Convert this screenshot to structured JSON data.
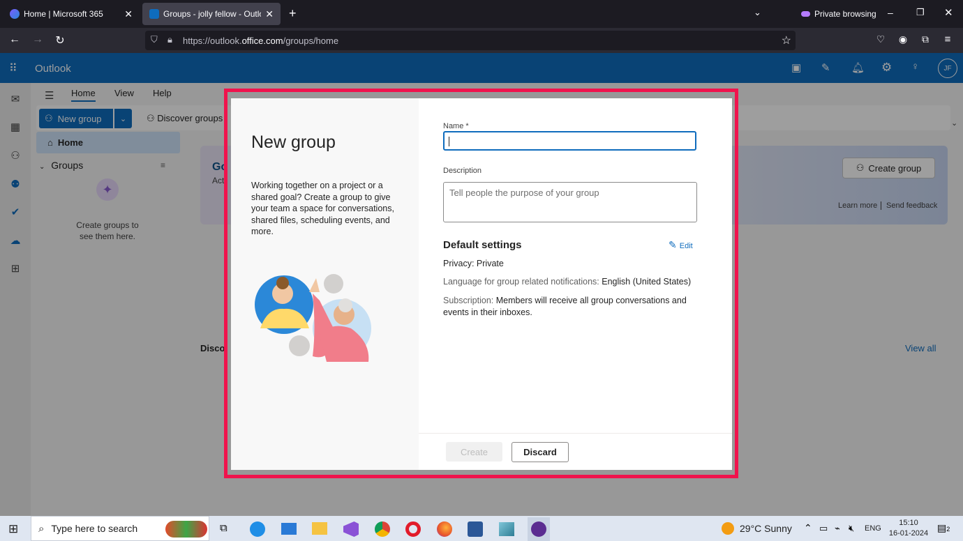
{
  "browser": {
    "tabs": [
      {
        "title": "Home | Microsoft 365",
        "active": false
      },
      {
        "title": "Groups - jolly fellow - Outlook",
        "active": true
      }
    ],
    "private_label": "Private browsing",
    "url_prefix": "https://outlook.",
    "url_domain": "office.com",
    "url_path": "/groups/home"
  },
  "outlook": {
    "app_title": "Outlook",
    "avatar_initials": "JF",
    "ribbon_tabs": [
      "Home",
      "View",
      "Help"
    ],
    "new_group_label": "New group",
    "discover_groups_label": "Discover groups",
    "nav_home": "Home",
    "groups_header": "Groups",
    "empty_groups_text_1": "Create groups to",
    "empty_groups_text_2": "see them here.",
    "banner_title_partial": "Go",
    "banner_sub_partial": "Acti",
    "create_group_label": "Create group",
    "learn_more": "Learn more",
    "send_feedback": "Send feedback",
    "discover_partial": "Disco",
    "view_all": "View all"
  },
  "dialog": {
    "title": "New group",
    "description_text": "Working together on a project or a shared goal? Create a group to give your team a space for conversations, shared files, scheduling events, and more.",
    "name_label": "Name *",
    "name_value": "",
    "description_label": "Description",
    "description_placeholder": "Tell people the purpose of your group",
    "default_settings_title": "Default settings",
    "edit_label": "Edit",
    "privacy_text": "Privacy: Private",
    "language_label": "Language for group related notifications:",
    "language_value": "English (United States)",
    "subscription_label": "Subscription:",
    "subscription_value": "Members will receive all group conversations and events in their inboxes.",
    "create_button": "Create",
    "discard_button": "Discard"
  },
  "taskbar": {
    "search_placeholder": "Type here to search",
    "weather": "29°C  Sunny",
    "language": "ENG",
    "time": "15:10",
    "date": "16-01-2024",
    "notification_count": "2"
  },
  "colors": {
    "brand": "#0f6cbd",
    "highlight_frame": "#f0134d"
  }
}
